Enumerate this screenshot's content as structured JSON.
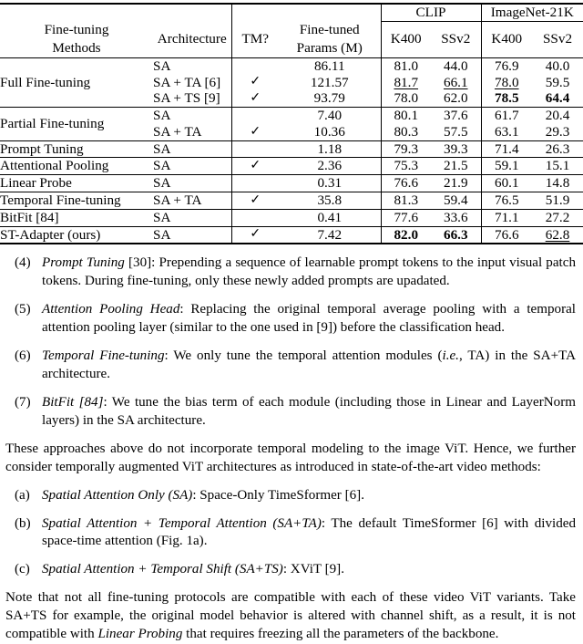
{
  "table": {
    "header": {
      "col_method": "Fine-tuning\nMethods",
      "col_method_l1": "Fine-tuning",
      "col_method_l2": "Methods",
      "col_architecture": "Architecture",
      "col_tm": "TM?",
      "col_params_l1": "Fine-tuned",
      "col_params_l2": "Params (M)",
      "group_clip": "CLIP",
      "group_in21k": "ImageNet-21K",
      "clip_k400": "K400",
      "clip_ssv2": "SSv2",
      "in21k_k400": "K400",
      "in21k_ssv2": "SSv2"
    },
    "check_glyph": "✓",
    "groups": [
      {
        "method": "Full Fine-tuning",
        "rows": [
          {
            "arch": "SA",
            "tm": "",
            "params": "86.11",
            "clip_k400": {
              "v": "81.0",
              "style": "normal"
            },
            "clip_ssv2": {
              "v": "44.0",
              "style": "normal"
            },
            "in21k_k400": {
              "v": "76.9",
              "style": "normal"
            },
            "in21k_ssv2": {
              "v": "40.0",
              "style": "normal"
            }
          },
          {
            "arch": "SA + TA [6]",
            "tm": "✓",
            "params": "121.57",
            "clip_k400": {
              "v": "81.7",
              "style": "underline"
            },
            "clip_ssv2": {
              "v": "66.1",
              "style": "underline"
            },
            "in21k_k400": {
              "v": "78.0",
              "style": "underline"
            },
            "in21k_ssv2": {
              "v": "59.5",
              "style": "normal"
            }
          },
          {
            "arch": "SA + TS [9]",
            "tm": "✓",
            "params": "93.79",
            "clip_k400": {
              "v": "78.0",
              "style": "normal"
            },
            "clip_ssv2": {
              "v": "62.0",
              "style": "normal"
            },
            "in21k_k400": {
              "v": "78.5",
              "style": "bold"
            },
            "in21k_ssv2": {
              "v": "64.4",
              "style": "bold"
            }
          }
        ]
      },
      {
        "method": "Partial Fine-tuning",
        "rows": [
          {
            "arch": "SA",
            "tm": "",
            "params": "7.40",
            "clip_k400": {
              "v": "80.1",
              "style": "normal"
            },
            "clip_ssv2": {
              "v": "37.6",
              "style": "normal"
            },
            "in21k_k400": {
              "v": "61.7",
              "style": "normal"
            },
            "in21k_ssv2": {
              "v": "20.4",
              "style": "normal"
            }
          },
          {
            "arch": "SA + TA",
            "tm": "✓",
            "params": "10.36",
            "clip_k400": {
              "v": "80.3",
              "style": "normal"
            },
            "clip_ssv2": {
              "v": "57.5",
              "style": "normal"
            },
            "in21k_k400": {
              "v": "63.1",
              "style": "normal"
            },
            "in21k_ssv2": {
              "v": "29.3",
              "style": "normal"
            }
          }
        ]
      },
      {
        "method": "Prompt Tuning",
        "rows": [
          {
            "arch": "SA",
            "tm": "",
            "params": "1.18",
            "clip_k400": {
              "v": "79.3",
              "style": "normal"
            },
            "clip_ssv2": {
              "v": "39.3",
              "style": "normal"
            },
            "in21k_k400": {
              "v": "71.4",
              "style": "normal"
            },
            "in21k_ssv2": {
              "v": "26.3",
              "style": "normal"
            }
          }
        ]
      },
      {
        "method": "Attentional Pooling",
        "rows": [
          {
            "arch": "SA",
            "tm": "✓",
            "params": "2.36",
            "clip_k400": {
              "v": "75.3",
              "style": "normal"
            },
            "clip_ssv2": {
              "v": "21.5",
              "style": "normal"
            },
            "in21k_k400": {
              "v": "59.1",
              "style": "normal"
            },
            "in21k_ssv2": {
              "v": "15.1",
              "style": "normal"
            }
          }
        ]
      },
      {
        "method": "Linear Probe",
        "rows": [
          {
            "arch": "SA",
            "tm": "",
            "params": "0.31",
            "clip_k400": {
              "v": "76.6",
              "style": "normal"
            },
            "clip_ssv2": {
              "v": "21.9",
              "style": "normal"
            },
            "in21k_k400": {
              "v": "60.1",
              "style": "normal"
            },
            "in21k_ssv2": {
              "v": "14.8",
              "style": "normal"
            }
          }
        ]
      },
      {
        "method": "Temporal Fine-tuning",
        "rows": [
          {
            "arch": "SA + TA",
            "tm": "✓",
            "params": "35.8",
            "clip_k400": {
              "v": "81.3",
              "style": "normal"
            },
            "clip_ssv2": {
              "v": "59.4",
              "style": "normal"
            },
            "in21k_k400": {
              "v": "76.5",
              "style": "normal"
            },
            "in21k_ssv2": {
              "v": "51.9",
              "style": "normal"
            }
          }
        ]
      },
      {
        "method": "BitFit [84]",
        "rows": [
          {
            "arch": "SA",
            "tm": "",
            "params": "0.41",
            "clip_k400": {
              "v": "77.6",
              "style": "normal"
            },
            "clip_ssv2": {
              "v": "33.6",
              "style": "normal"
            },
            "in21k_k400": {
              "v": "71.1",
              "style": "normal"
            },
            "in21k_ssv2": {
              "v": "27.2",
              "style": "normal"
            }
          }
        ]
      },
      {
        "method": "ST-Adapter (ours)",
        "rows": [
          {
            "arch": "SA",
            "tm": "✓",
            "params": "7.42",
            "clip_k400": {
              "v": "82.0",
              "style": "bold"
            },
            "clip_ssv2": {
              "v": "66.3",
              "style": "bold"
            },
            "in21k_k400": {
              "v": "76.6",
              "style": "normal"
            },
            "in21k_ssv2": {
              "v": "62.8",
              "style": "underline"
            }
          }
        ]
      }
    ]
  },
  "items": [
    {
      "marker": "(4)",
      "title": "Prompt Tuning",
      "title_style": "italic",
      "after_title": " [30]: Prepending a sequence of learnable prompt tokens to the input visual patch tokens. During fine-tuning, only these newly added prompts are upadated."
    },
    {
      "marker": "(5)",
      "title": "Attention Pooling Head",
      "title_style": "italic",
      "after_title": ": Replacing the original temporal average pooling with a temporal attention pooling layer (similar to the one used in [9]) before the classification head."
    },
    {
      "marker": "(6)",
      "title": "Temporal Fine-tuning",
      "title_style": "italic",
      "after_title": ": We only tune the temporal attention modules (",
      "mid_italic": "i.e.",
      "after_mid": ", TA) in the SA+TA architecture."
    },
    {
      "marker": "(7)",
      "title": "BitFit [84]",
      "title_style": "italic",
      "after_title": ": We tune the bias term of each module (including those in Linear and LayerNorm layers) in the SA architecture."
    }
  ],
  "paragraph_1": "These approaches above do not incorporate temporal modeling to the image ViT. Hence, we further consider temporally augmented ViT architectures as introduced in state-of-the-art video methods:",
  "items2": [
    {
      "marker": "(a)",
      "title": "Spatial Attention Only (SA)",
      "after_title": ": Space-Only TimeSformer [6]."
    },
    {
      "marker": "(b)",
      "title": "Spatial Attention + Temporal Attention (SA+TA)",
      "after_title": ": The default TimeSformer [6] with divided space-time attention (Fig. 1a)."
    },
    {
      "marker": "(c)",
      "title": "Spatial Attention + Temporal Shift (SA+TS)",
      "after_title": ": XViT [9]."
    }
  ],
  "paragraph_2_part1": "Note that not all fine-tuning protocols are compatible with each of these video ViT variants. Take SA+TS for example, the original model behavior is altered with channel shift, as a result, it is not compatible with ",
  "paragraph_2_italic": "Linear Probing",
  "paragraph_2_part2": " that requires freezing all the parameters of the backbone."
}
